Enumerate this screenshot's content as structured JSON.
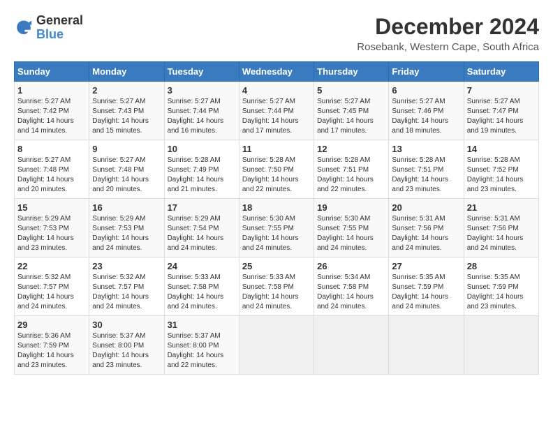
{
  "header": {
    "logo_general": "General",
    "logo_blue": "Blue",
    "month": "December 2024",
    "location": "Rosebank, Western Cape, South Africa"
  },
  "weekdays": [
    "Sunday",
    "Monday",
    "Tuesday",
    "Wednesday",
    "Thursday",
    "Friday",
    "Saturday"
  ],
  "weeks": [
    [
      {
        "day": "1",
        "sunrise": "5:27 AM",
        "sunset": "7:42 PM",
        "daylight": "14 hours and 14 minutes."
      },
      {
        "day": "2",
        "sunrise": "5:27 AM",
        "sunset": "7:43 PM",
        "daylight": "14 hours and 15 minutes."
      },
      {
        "day": "3",
        "sunrise": "5:27 AM",
        "sunset": "7:44 PM",
        "daylight": "14 hours and 16 minutes."
      },
      {
        "day": "4",
        "sunrise": "5:27 AM",
        "sunset": "7:44 PM",
        "daylight": "14 hours and 17 minutes."
      },
      {
        "day": "5",
        "sunrise": "5:27 AM",
        "sunset": "7:45 PM",
        "daylight": "14 hours and 17 minutes."
      },
      {
        "day": "6",
        "sunrise": "5:27 AM",
        "sunset": "7:46 PM",
        "daylight": "14 hours and 18 minutes."
      },
      {
        "day": "7",
        "sunrise": "5:27 AM",
        "sunset": "7:47 PM",
        "daylight": "14 hours and 19 minutes."
      }
    ],
    [
      {
        "day": "8",
        "sunrise": "5:27 AM",
        "sunset": "7:48 PM",
        "daylight": "14 hours and 20 minutes."
      },
      {
        "day": "9",
        "sunrise": "5:27 AM",
        "sunset": "7:48 PM",
        "daylight": "14 hours and 20 minutes."
      },
      {
        "day": "10",
        "sunrise": "5:28 AM",
        "sunset": "7:49 PM",
        "daylight": "14 hours and 21 minutes."
      },
      {
        "day": "11",
        "sunrise": "5:28 AM",
        "sunset": "7:50 PM",
        "daylight": "14 hours and 22 minutes."
      },
      {
        "day": "12",
        "sunrise": "5:28 AM",
        "sunset": "7:51 PM",
        "daylight": "14 hours and 22 minutes."
      },
      {
        "day": "13",
        "sunrise": "5:28 AM",
        "sunset": "7:51 PM",
        "daylight": "14 hours and 23 minutes."
      },
      {
        "day": "14",
        "sunrise": "5:28 AM",
        "sunset": "7:52 PM",
        "daylight": "14 hours and 23 minutes."
      }
    ],
    [
      {
        "day": "15",
        "sunrise": "5:29 AM",
        "sunset": "7:53 PM",
        "daylight": "14 hours and 23 minutes."
      },
      {
        "day": "16",
        "sunrise": "5:29 AM",
        "sunset": "7:53 PM",
        "daylight": "14 hours and 24 minutes."
      },
      {
        "day": "17",
        "sunrise": "5:29 AM",
        "sunset": "7:54 PM",
        "daylight": "14 hours and 24 minutes."
      },
      {
        "day": "18",
        "sunrise": "5:30 AM",
        "sunset": "7:55 PM",
        "daylight": "14 hours and 24 minutes."
      },
      {
        "day": "19",
        "sunrise": "5:30 AM",
        "sunset": "7:55 PM",
        "daylight": "14 hours and 24 minutes."
      },
      {
        "day": "20",
        "sunrise": "5:31 AM",
        "sunset": "7:56 PM",
        "daylight": "14 hours and 24 minutes."
      },
      {
        "day": "21",
        "sunrise": "5:31 AM",
        "sunset": "7:56 PM",
        "daylight": "14 hours and 24 minutes."
      }
    ],
    [
      {
        "day": "22",
        "sunrise": "5:32 AM",
        "sunset": "7:57 PM",
        "daylight": "14 hours and 24 minutes."
      },
      {
        "day": "23",
        "sunrise": "5:32 AM",
        "sunset": "7:57 PM",
        "daylight": "14 hours and 24 minutes."
      },
      {
        "day": "24",
        "sunrise": "5:33 AM",
        "sunset": "7:58 PM",
        "daylight": "14 hours and 24 minutes."
      },
      {
        "day": "25",
        "sunrise": "5:33 AM",
        "sunset": "7:58 PM",
        "daylight": "14 hours and 24 minutes."
      },
      {
        "day": "26",
        "sunrise": "5:34 AM",
        "sunset": "7:58 PM",
        "daylight": "14 hours and 24 minutes."
      },
      {
        "day": "27",
        "sunrise": "5:35 AM",
        "sunset": "7:59 PM",
        "daylight": "14 hours and 24 minutes."
      },
      {
        "day": "28",
        "sunrise": "5:35 AM",
        "sunset": "7:59 PM",
        "daylight": "14 hours and 23 minutes."
      }
    ],
    [
      {
        "day": "29",
        "sunrise": "5:36 AM",
        "sunset": "7:59 PM",
        "daylight": "14 hours and 23 minutes."
      },
      {
        "day": "30",
        "sunrise": "5:37 AM",
        "sunset": "8:00 PM",
        "daylight": "14 hours and 23 minutes."
      },
      {
        "day": "31",
        "sunrise": "5:37 AM",
        "sunset": "8:00 PM",
        "daylight": "14 hours and 22 minutes."
      },
      null,
      null,
      null,
      null
    ]
  ]
}
